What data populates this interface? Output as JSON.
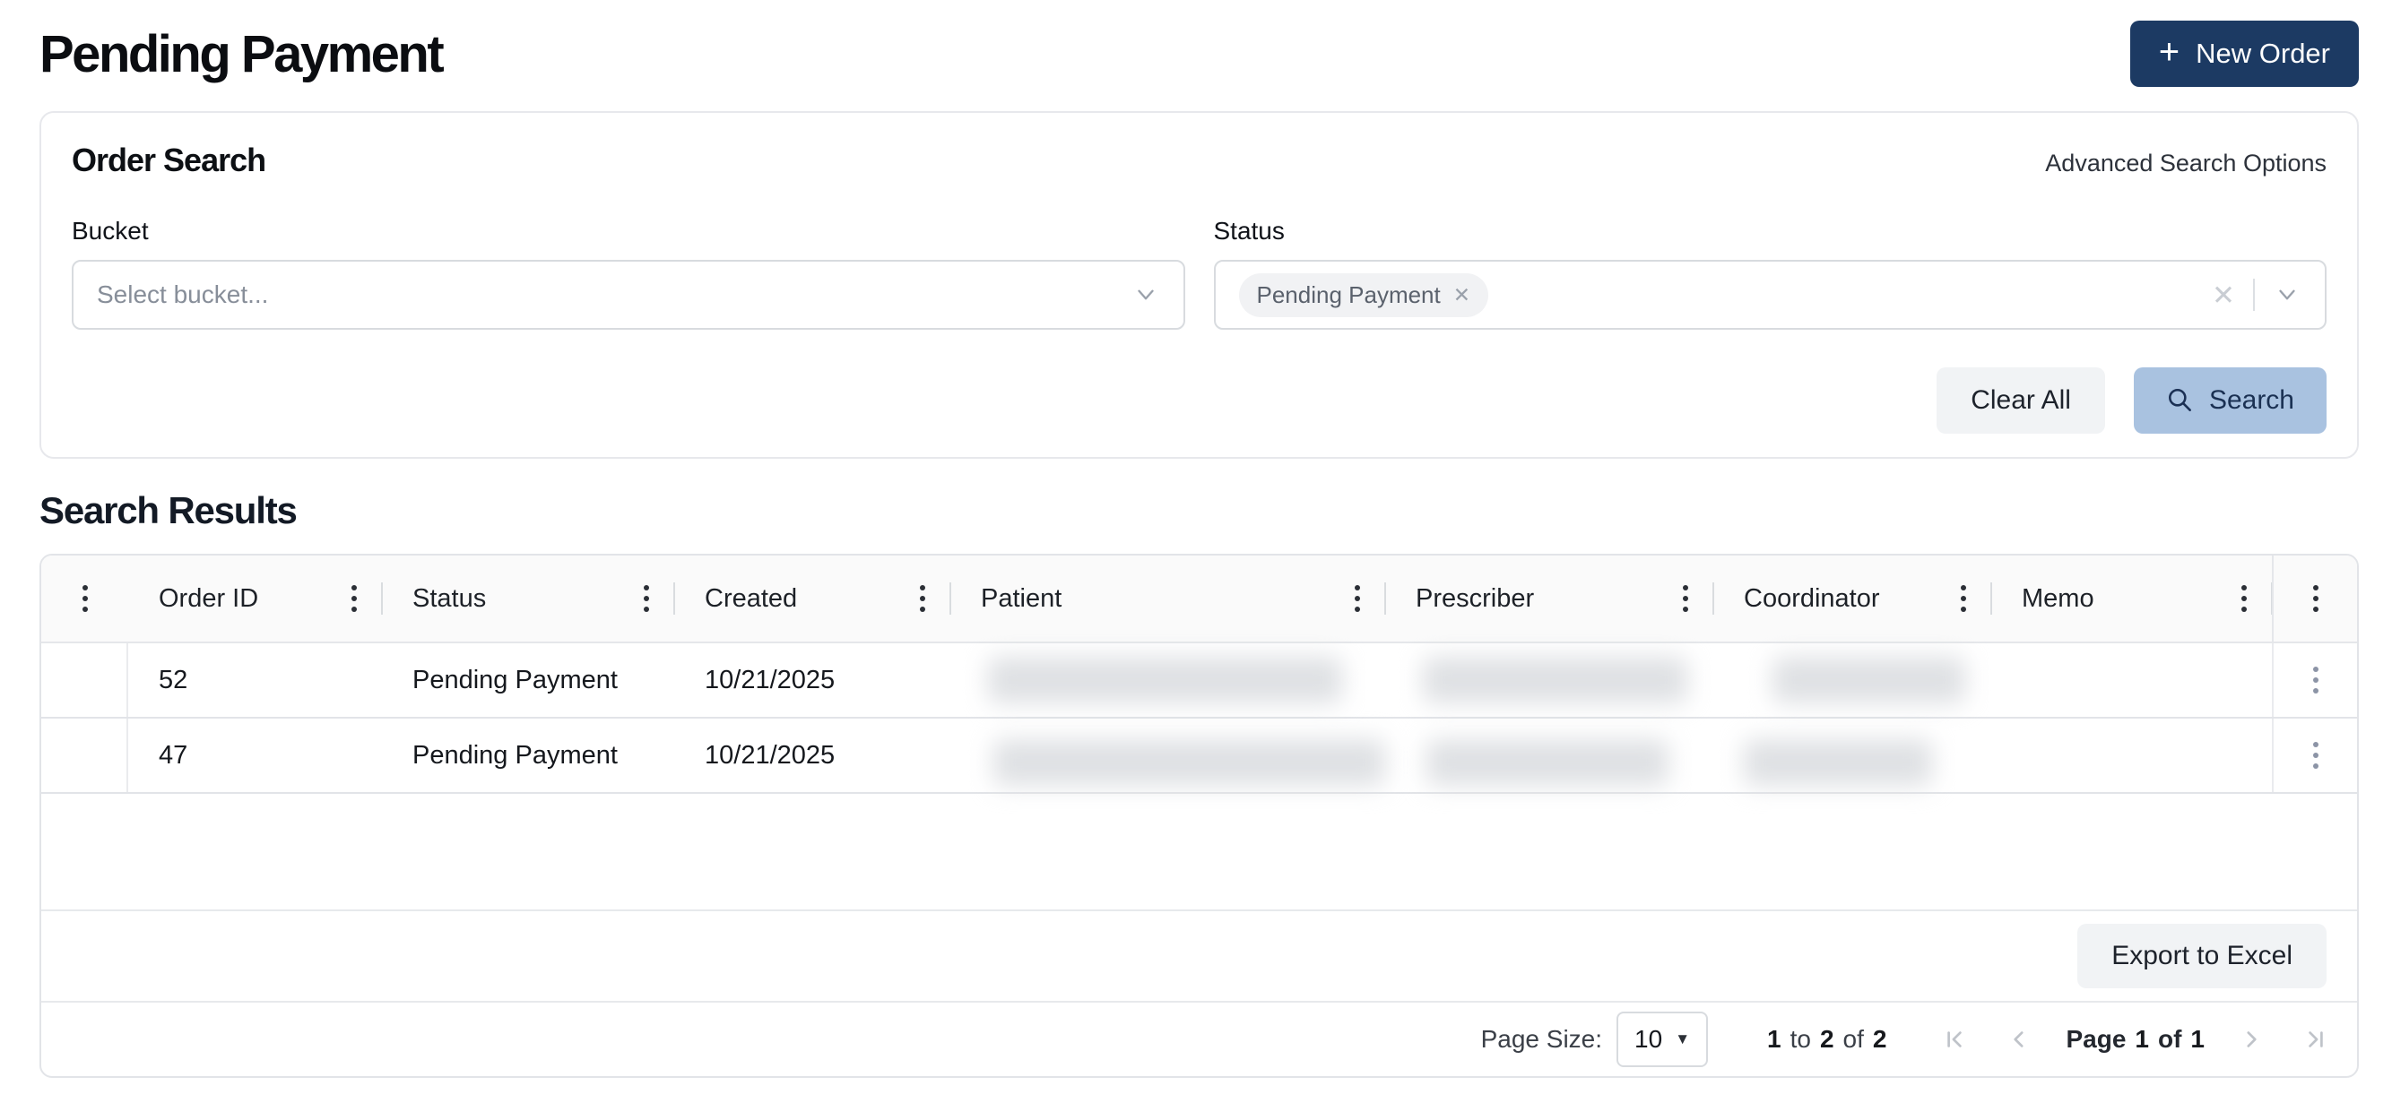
{
  "page": {
    "title": "Pending Payment"
  },
  "header": {
    "new_order_label": "New Order",
    "plus_icon": "+"
  },
  "search_card": {
    "title": "Order Search",
    "advanced_link": "Advanced Search Options",
    "bucket": {
      "label": "Bucket",
      "placeholder": "Select bucket..."
    },
    "status": {
      "label": "Status",
      "chip": "Pending Payment",
      "chip_remove_icon": "✕",
      "clear_icon": "✕"
    },
    "clear_all_label": "Clear All",
    "search_label": "Search"
  },
  "results": {
    "title": "Search Results",
    "columns": [
      "Order ID",
      "Status",
      "Created",
      "Patient",
      "Prescriber",
      "Coordinator",
      "Memo"
    ],
    "rows": [
      {
        "order_id": "52",
        "status": "Pending Payment",
        "created": "10/21/2025"
      },
      {
        "order_id": "47",
        "status": "Pending Payment",
        "created": "10/21/2025"
      }
    ],
    "export_label": "Export to Excel"
  },
  "pagination": {
    "page_size_label": "Page Size:",
    "page_size_value": "10",
    "caret_icon": "▼",
    "range": {
      "from": "1",
      "to_word": "to",
      "to": "2",
      "of_word": "of",
      "total": "2"
    },
    "page": {
      "word": "Page",
      "current": "1",
      "of_word": "of",
      "total": "1"
    }
  },
  "colors": {
    "primary_navy": "#1c3a63",
    "search_button_blue": "#a9c2e0",
    "neutral_button_gray": "#f1f3f5",
    "chip_background": "#f1f2f4",
    "table_header_background": "#fafafa",
    "border_light": "#e2e4e8",
    "row_kebab_gray": "#8c94a6",
    "pagination_icon_gray": "#bfc3c9"
  }
}
